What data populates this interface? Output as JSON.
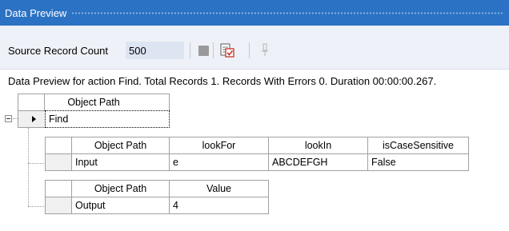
{
  "panel": {
    "title": "Data Preview"
  },
  "toolbar": {
    "source_count_label": "Source Record Count",
    "source_count_value": "500",
    "stop_icon": "stop-icon",
    "export_icon": "export-icon",
    "pin_icon": "pin-icon"
  },
  "status": {
    "text": "Data Preview for action Find. Total Records 1. Records With Errors 0. Duration 00:00:00.267."
  },
  "grid": {
    "header": "Object Path",
    "rows": [
      {
        "path": "Find"
      }
    ]
  },
  "input_table": {
    "columns": [
      "Object Path",
      "lookFor",
      "lookIn",
      "isCaseSensitive"
    ],
    "rows": [
      [
        "Input",
        "e",
        "ABCDEFGH",
        "False"
      ]
    ]
  },
  "output_table": {
    "columns": [
      "Object Path",
      "Value"
    ],
    "rows": [
      [
        "Output",
        "4"
      ]
    ]
  },
  "colors": {
    "titlebar": "#2b72c4",
    "toolbar_bg": "#eef1f7",
    "input_bg": "#dde5f3"
  }
}
